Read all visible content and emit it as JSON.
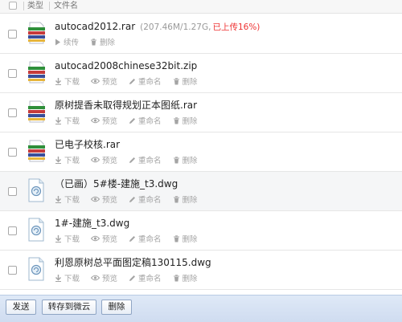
{
  "header": {
    "col_type": "类型",
    "col_filename": "文件名"
  },
  "files": [
    {
      "name": "autocad2012.rar",
      "meta": "(207.46M/1.27G,",
      "status": "已上传16%)",
      "actions": [
        "续传",
        "删除"
      ],
      "icon": "archive-icon"
    },
    {
      "name": "autocad2008chinese32bit.zip",
      "actions": [
        "下载",
        "预览",
        "重命名",
        "删除"
      ],
      "icon": "archive-icon"
    },
    {
      "name": "原树提香未取得规划正本图纸.rar",
      "actions": [
        "下载",
        "预览",
        "重命名",
        "删除"
      ],
      "icon": "archive-icon"
    },
    {
      "name": "已电子校核.rar",
      "actions": [
        "下载",
        "预览",
        "重命名",
        "删除"
      ],
      "icon": "archive-icon"
    },
    {
      "name": "（已画）5#楼-建施_t3.dwg",
      "actions": [
        "下载",
        "预览",
        "重命名",
        "删除"
      ],
      "icon": "dwg-file-icon"
    },
    {
      "name": "1#-建施_t3.dwg",
      "actions": [
        "下载",
        "预览",
        "重命名",
        "删除"
      ],
      "icon": "dwg-file-icon"
    },
    {
      "name": "利恩原树总平面图定稿130115.dwg",
      "actions": [
        "下载",
        "预览",
        "重命名",
        "删除"
      ],
      "icon": "dwg-file-icon"
    }
  ],
  "footer": {
    "send": "发送",
    "save_to_cloud": "转存到微云",
    "delete": "删除"
  },
  "colors": {
    "status_red": "#e33333",
    "footer_blue": "#d6e2f3",
    "action_gray": "#a4a4a4"
  }
}
